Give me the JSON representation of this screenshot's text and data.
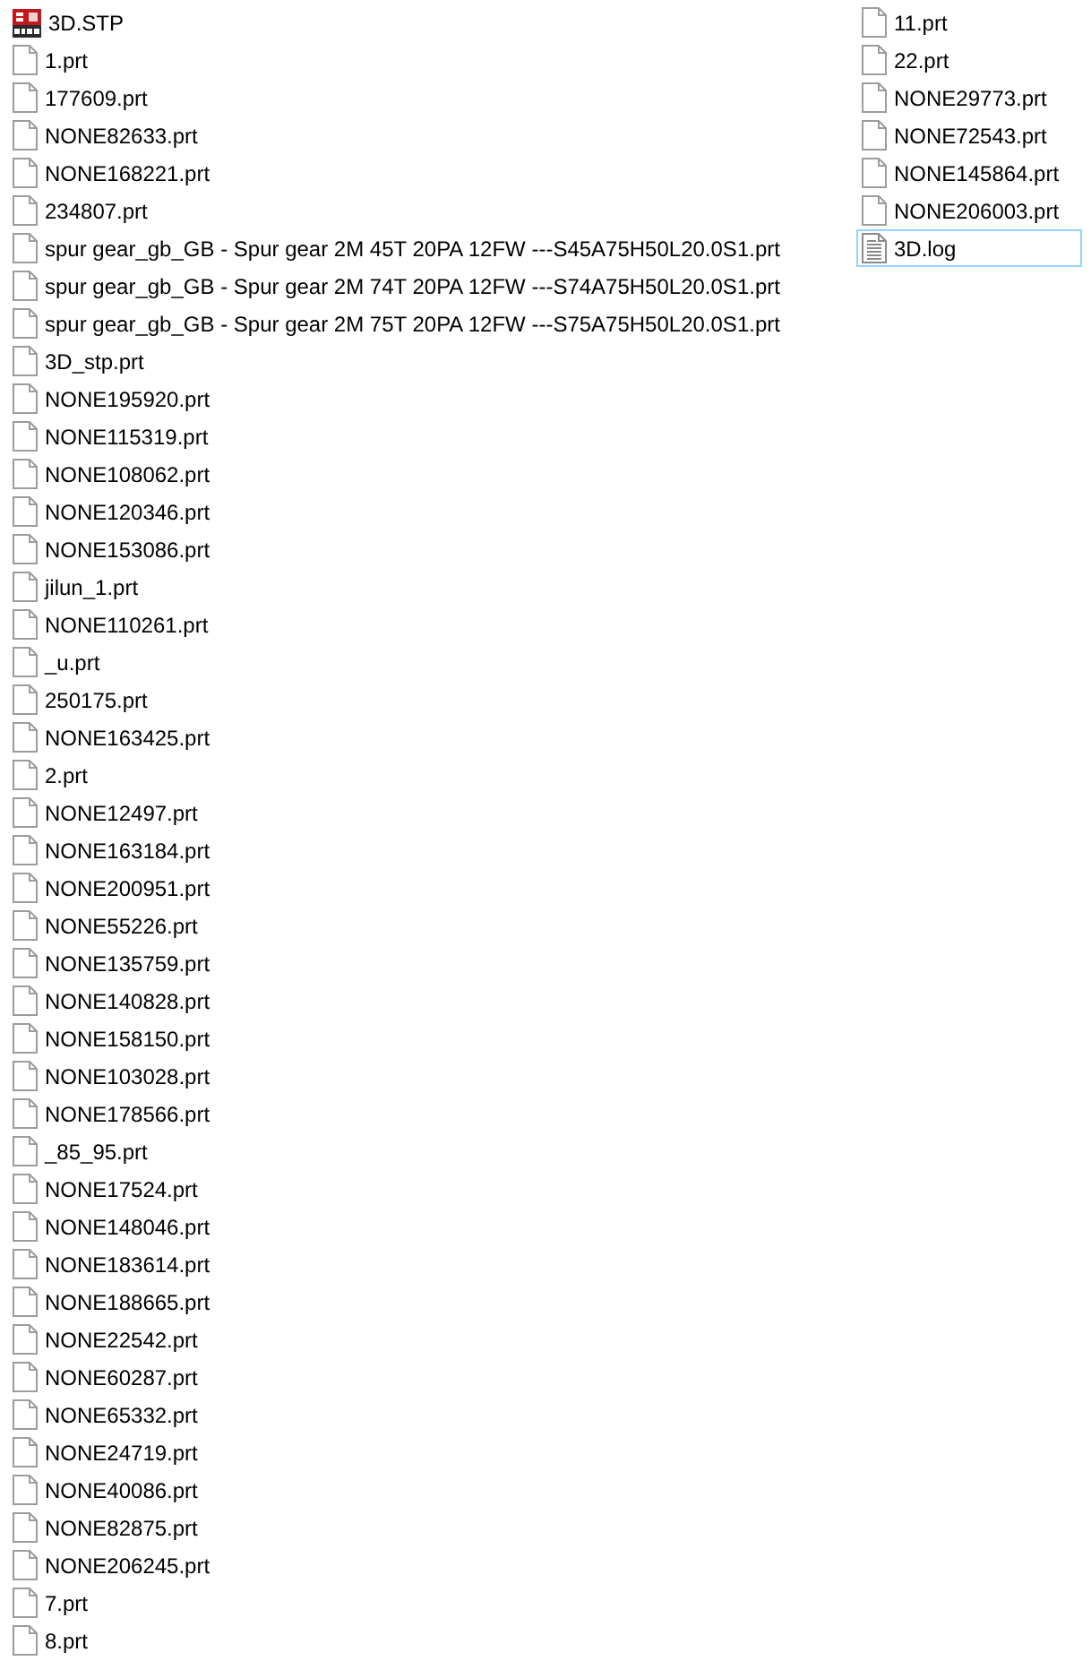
{
  "columns": [
    {
      "items": [
        {
          "name": "3D.STP",
          "kind": "stp",
          "focused": false
        },
        {
          "name": "1.prt",
          "kind": "prt",
          "focused": false
        },
        {
          "name": "177609.prt",
          "kind": "prt",
          "focused": false
        },
        {
          "name": "NONE82633.prt",
          "kind": "prt",
          "focused": false
        },
        {
          "name": "NONE168221.prt",
          "kind": "prt",
          "focused": false
        },
        {
          "name": "234807.prt",
          "kind": "prt",
          "focused": false
        },
        {
          "name": "spur gear_gb_GB - Spur gear 2M 45T 20PA 12FW ---S45A75H50L20.0S1.prt",
          "kind": "prt",
          "focused": false
        },
        {
          "name": "spur gear_gb_GB - Spur gear 2M 74T 20PA 12FW ---S74A75H50L20.0S1.prt",
          "kind": "prt",
          "focused": false
        },
        {
          "name": "spur gear_gb_GB - Spur gear 2M 75T 20PA 12FW ---S75A75H50L20.0S1.prt",
          "kind": "prt",
          "focused": false
        },
        {
          "name": "3D_stp.prt",
          "kind": "prt",
          "focused": false
        },
        {
          "name": "NONE195920.prt",
          "kind": "prt",
          "focused": false
        },
        {
          "name": "NONE115319.prt",
          "kind": "prt",
          "focused": false
        },
        {
          "name": "NONE108062.prt",
          "kind": "prt",
          "focused": false
        },
        {
          "name": "NONE120346.prt",
          "kind": "prt",
          "focused": false
        },
        {
          "name": "NONE153086.prt",
          "kind": "prt",
          "focused": false
        },
        {
          "name": "jilun_1.prt",
          "kind": "prt",
          "focused": false
        },
        {
          "name": "NONE110261.prt",
          "kind": "prt",
          "focused": false
        },
        {
          "name": "_u.prt",
          "kind": "prt",
          "focused": false
        },
        {
          "name": "250175.prt",
          "kind": "prt",
          "focused": false
        },
        {
          "name": "NONE163425.prt",
          "kind": "prt",
          "focused": false
        },
        {
          "name": "2.prt",
          "kind": "prt",
          "focused": false
        },
        {
          "name": "NONE12497.prt",
          "kind": "prt",
          "focused": false
        },
        {
          "name": "NONE163184.prt",
          "kind": "prt",
          "focused": false
        },
        {
          "name": "NONE200951.prt",
          "kind": "prt",
          "focused": false
        },
        {
          "name": "NONE55226.prt",
          "kind": "prt",
          "focused": false
        },
        {
          "name": "NONE135759.prt",
          "kind": "prt",
          "focused": false
        },
        {
          "name": "NONE140828.prt",
          "kind": "prt",
          "focused": false
        },
        {
          "name": "NONE158150.prt",
          "kind": "prt",
          "focused": false
        },
        {
          "name": "NONE103028.prt",
          "kind": "prt",
          "focused": false
        },
        {
          "name": "NONE178566.prt",
          "kind": "prt",
          "focused": false
        },
        {
          "name": "_85_95.prt",
          "kind": "prt",
          "focused": false
        },
        {
          "name": "NONE17524.prt",
          "kind": "prt",
          "focused": false
        },
        {
          "name": "NONE148046.prt",
          "kind": "prt",
          "focused": false
        },
        {
          "name": "NONE183614.prt",
          "kind": "prt",
          "focused": false
        },
        {
          "name": "NONE188665.prt",
          "kind": "prt",
          "focused": false
        },
        {
          "name": "NONE22542.prt",
          "kind": "prt",
          "focused": false
        },
        {
          "name": "NONE60287.prt",
          "kind": "prt",
          "focused": false
        },
        {
          "name": "NONE65332.prt",
          "kind": "prt",
          "focused": false
        },
        {
          "name": "NONE24719.prt",
          "kind": "prt",
          "focused": false
        },
        {
          "name": "NONE40086.prt",
          "kind": "prt",
          "focused": false
        },
        {
          "name": "NONE82875.prt",
          "kind": "prt",
          "focused": false
        },
        {
          "name": "NONE206245.prt",
          "kind": "prt",
          "focused": false
        },
        {
          "name": "7.prt",
          "kind": "prt",
          "focused": false
        },
        {
          "name": "8.prt",
          "kind": "prt",
          "focused": false
        }
      ]
    },
    {
      "items": [
        {
          "name": "11.prt",
          "kind": "prt",
          "focused": false
        },
        {
          "name": "22.prt",
          "kind": "prt",
          "focused": false
        },
        {
          "name": "NONE29773.prt",
          "kind": "prt",
          "focused": false
        },
        {
          "name": "NONE72543.prt",
          "kind": "prt",
          "focused": false
        },
        {
          "name": "NONE145864.prt",
          "kind": "prt",
          "focused": false
        },
        {
          "name": "NONE206003.prt",
          "kind": "prt",
          "focused": false
        },
        {
          "name": "3D.log",
          "kind": "log",
          "focused": true
        }
      ]
    }
  ]
}
